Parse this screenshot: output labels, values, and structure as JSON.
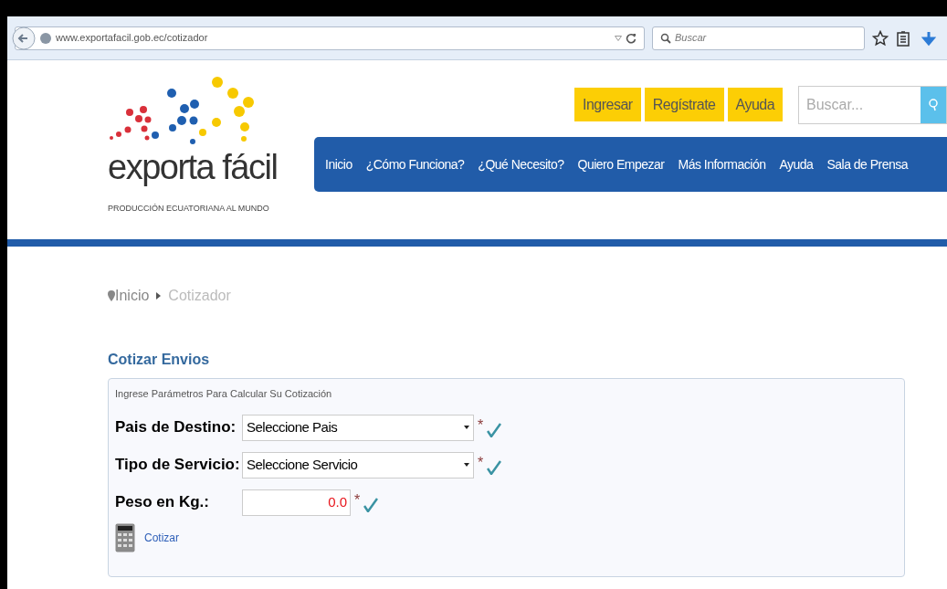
{
  "browser": {
    "url": "www.exportafacil.gob.ec/cotizador",
    "search_placeholder": "Buscar"
  },
  "logo": {
    "name": "exporta fácil",
    "tagline": "PRODUCCIÓN ECUATORIANA AL MUNDO"
  },
  "top_buttons": [
    "Ingresar",
    "Regístrate",
    "Ayuda"
  ],
  "site_search": {
    "placeholder": "Buscar..."
  },
  "nav": [
    "Inicio",
    "¿Cómo Funciona?",
    "¿Qué Necesito?",
    "Quiero Empezar",
    "Más Información",
    "Ayuda",
    "Sala de Prensa"
  ],
  "breadcrumb": [
    "Inicio",
    "Cotizador"
  ],
  "section_title": "Cotizar Envios",
  "panel": {
    "legend": "Ingrese Parámetros Para Calcular Su Cotización",
    "fields": [
      {
        "kind": "select",
        "label": "Pais de Destino:",
        "value": "Seleccione Pais",
        "required_mark": "*"
      },
      {
        "kind": "select",
        "label": "Tipo de Servicio:",
        "value": "Seleccione Servicio",
        "required_mark": "*"
      },
      {
        "kind": "number",
        "label": "Peso en Kg.:",
        "value": "0.0",
        "required_mark": "*"
      }
    ],
    "action": "Cotizar"
  }
}
